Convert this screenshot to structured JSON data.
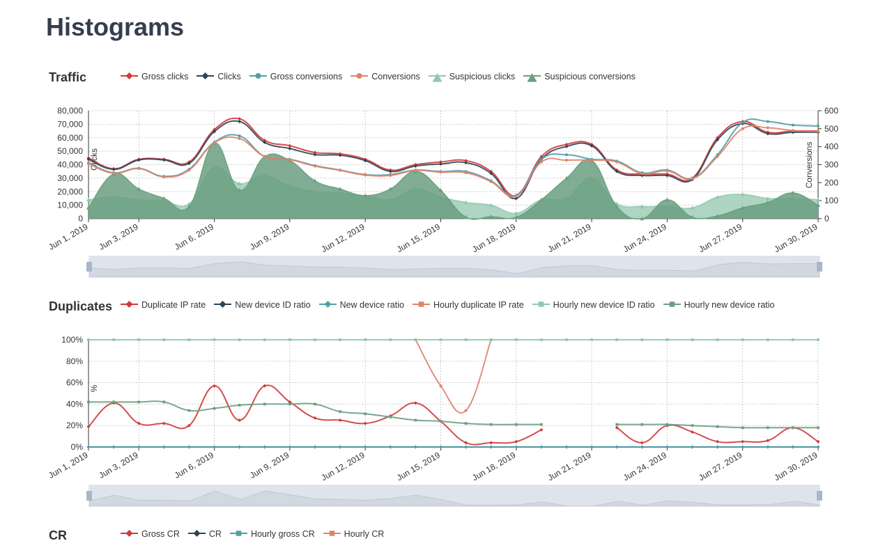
{
  "page_title": "Histograms",
  "colors": {
    "gross": "#d0393a",
    "net": "#2f4554",
    "grossConv": "#4f9fa6",
    "conv": "#e0836a",
    "suspClicks": "#91c7ae",
    "suspConv": "#6a9f80"
  },
  "chart_data": [
    {
      "type": "line",
      "title": "Traffic",
      "x": [
        "Jun 1, 2019",
        "Jun 2, 2019",
        "Jun 3, 2019",
        "Jun 4, 2019",
        "Jun 5, 2019",
        "Jun 6, 2019",
        "Jun 7, 2019",
        "Jun 8, 2019",
        "Jun 9, 2019",
        "Jun 10, 2019",
        "Jun 11, 2019",
        "Jun 12, 2019",
        "Jun 13, 2019",
        "Jun 14, 2019",
        "Jun 15, 2019",
        "Jun 16, 2019",
        "Jun 17, 2019",
        "Jun 18, 2019",
        "Jun 19, 2019",
        "Jun 20, 2019",
        "Jun 21, 2019",
        "Jun 22, 2019",
        "Jun 23, 2019",
        "Jun 24, 2019",
        "Jun 25, 2019",
        "Jun 26, 2019",
        "Jun 27, 2019",
        "Jun 28, 2019",
        "Jun 29, 2019",
        "Jun 30, 2019"
      ],
      "x_tick_labels": [
        "Jun 1, 2019",
        "Jun 3, 2019",
        "Jun 6, 2019",
        "Jun 9, 2019",
        "Jun 12, 2019",
        "Jun 15, 2019",
        "Jun 18, 2019",
        "Jun 21, 2019",
        "Jun 24, 2019",
        "Jun 27, 2019",
        "Jun 30, 2019"
      ],
      "ylabel": "Clicks",
      "y2label": "Conversions",
      "ylim": [
        0,
        80000
      ],
      "y_ticks": [
        "0",
        "10,000",
        "20,000",
        "30,000",
        "40,000",
        "50,000",
        "60,000",
        "70,000",
        "80,000"
      ],
      "y2lim": [
        0,
        600
      ],
      "y2_ticks": [
        "0",
        "100",
        "200",
        "300",
        "400",
        "500",
        "600"
      ],
      "grid": true,
      "legend": "top",
      "zoom_slider": true,
      "series": [
        {
          "name": "Gross clicks",
          "axis": "left",
          "kind": "line",
          "color": "#d0393a",
          "marker": "diamond",
          "values": [
            45000,
            37000,
            44000,
            44000,
            42000,
            66000,
            74000,
            58000,
            54000,
            49000,
            48000,
            44000,
            36000,
            40000,
            42000,
            43000,
            35000,
            17000,
            46000,
            55000,
            55000,
            36000,
            33000,
            33000,
            30000,
            60000,
            72000,
            64000,
            65000,
            65000
          ]
        },
        {
          "name": "Clicks",
          "axis": "left",
          "kind": "line",
          "color": "#2f4554",
          "marker": "diamond",
          "values": [
            44000,
            36500,
            43500,
            43500,
            41000,
            64500,
            72000,
            56500,
            52000,
            47500,
            47000,
            43000,
            35000,
            39000,
            40500,
            41500,
            33500,
            15000,
            44000,
            53500,
            54000,
            35000,
            32000,
            32000,
            29000,
            58500,
            70500,
            63000,
            64000,
            64000
          ]
        },
        {
          "name": "Gross conversions",
          "axis": "right",
          "kind": "line",
          "color": "#4f9fa6",
          "marker": "circle",
          "values": [
            310,
            255,
            280,
            235,
            275,
            425,
            460,
            345,
            330,
            295,
            270,
            245,
            245,
            270,
            262,
            262,
            210,
            130,
            330,
            355,
            330,
            320,
            255,
            270,
            225,
            355,
            535,
            540,
            520,
            515
          ]
        },
        {
          "name": "Conversions",
          "axis": "right",
          "kind": "line",
          "color": "#e0836a",
          "marker": "circle",
          "values": [
            305,
            252,
            278,
            232,
            270,
            422,
            445,
            345,
            328,
            292,
            268,
            242,
            240,
            268,
            258,
            255,
            205,
            125,
            315,
            325,
            325,
            315,
            250,
            265,
            222,
            345,
            500,
            505,
            490,
            485
          ]
        },
        {
          "name": "Suspicious clicks",
          "axis": "left",
          "kind": "area",
          "color": "#91c7ae",
          "marker": "triangle",
          "values": [
            14000,
            16000,
            14000,
            13000,
            11000,
            38000,
            26000,
            32000,
            24000,
            20000,
            19000,
            17000,
            14000,
            22000,
            16000,
            12000,
            10000,
            4000,
            14000,
            15000,
            30000,
            11000,
            9000,
            9000,
            8000,
            16000,
            18000,
            15000,
            15000,
            14000
          ]
        },
        {
          "name": "Suspicious conversions",
          "axis": "right",
          "kind": "area",
          "color": "#6a9f80",
          "marker": "triangle",
          "values": [
            60,
            248,
            165,
            113,
            68,
            420,
            158,
            345,
            323,
            210,
            165,
            128,
            165,
            263,
            158,
            8,
            11,
            8,
            105,
            225,
            323,
            68,
            0,
            105,
            8,
            15,
            60,
            90,
            143,
            75
          ]
        }
      ]
    },
    {
      "type": "line",
      "title": "Duplicates",
      "ylabel": "%",
      "ylim": [
        0,
        100
      ],
      "y_ticks": [
        "0%",
        "20%",
        "40%",
        "60%",
        "80%",
        "100%"
      ],
      "grid": true,
      "legend": "top",
      "zoom_slider": true,
      "series": [
        {
          "name": "Duplicate IP rate",
          "kind": "line",
          "color": "#d0393a",
          "marker": "diamond",
          "values": [
            19,
            41,
            22,
            22,
            20,
            57,
            25,
            57,
            42,
            27,
            25,
            22,
            29,
            41,
            24,
            4,
            4,
            5,
            16,
            null,
            null,
            18,
            4,
            20,
            14,
            5,
            5,
            6,
            18,
            5
          ]
        },
        {
          "name": "New device ID ratio",
          "kind": "line",
          "color": "#2f4554",
          "marker": "diamond",
          "values": [
            0,
            0,
            0,
            0,
            0,
            0,
            0,
            0,
            0,
            0,
            0,
            0,
            0,
            0,
            0,
            0,
            0,
            0,
            0,
            0,
            0,
            0,
            0,
            0,
            0,
            0,
            0,
            0,
            0,
            0
          ]
        },
        {
          "name": "New device ratio",
          "kind": "line",
          "color": "#4f9fa6",
          "marker": "diamond",
          "values": [
            0,
            0,
            0,
            0,
            0,
            0,
            0,
            0,
            0,
            0,
            0,
            0,
            0,
            0,
            0,
            0,
            0,
            0,
            0,
            0,
            0,
            0,
            0,
            0,
            0,
            0,
            0,
            0,
            0,
            0
          ]
        },
        {
          "name": "Hourly duplicate IP rate",
          "kind": "line",
          "color": "#e0836a",
          "marker": "square",
          "values": [
            null,
            null,
            null,
            null,
            null,
            null,
            null,
            null,
            null,
            null,
            null,
            null,
            null,
            100,
            57,
            34,
            100,
            null,
            null,
            null,
            null,
            null,
            null,
            null,
            null,
            null,
            null,
            null,
            null,
            null
          ]
        },
        {
          "name": "Hourly new device ID ratio",
          "kind": "line",
          "color": "#91c7ae",
          "marker": "square",
          "values": [
            100,
            100,
            100,
            100,
            100,
            100,
            100,
            100,
            100,
            100,
            100,
            100,
            100,
            100,
            100,
            100,
            100,
            100,
            100,
            100,
            100,
            100,
            100,
            100,
            100,
            100,
            100,
            100,
            100,
            100
          ]
        },
        {
          "name": "Hourly new device ratio",
          "kind": "line",
          "color": "#6a9f80",
          "marker": "square",
          "values": [
            42,
            42,
            42,
            42,
            34,
            36,
            39,
            40,
            40,
            40,
            33,
            31,
            28,
            25,
            24,
            22,
            21,
            21,
            21,
            null,
            null,
            21,
            21,
            21,
            20,
            19,
            18,
            18,
            18,
            18
          ]
        }
      ]
    },
    {
      "type": "line",
      "title": "CR",
      "legend": "top",
      "series": [
        {
          "name": "Gross CR",
          "color": "#d0393a",
          "marker": "diamond"
        },
        {
          "name": "CR",
          "color": "#2f4554",
          "marker": "diamond"
        },
        {
          "name": "Hourly gross CR",
          "color": "#4f9fa6",
          "marker": "square"
        },
        {
          "name": "Hourly CR",
          "color": "#e0836a",
          "marker": "square"
        }
      ]
    }
  ]
}
